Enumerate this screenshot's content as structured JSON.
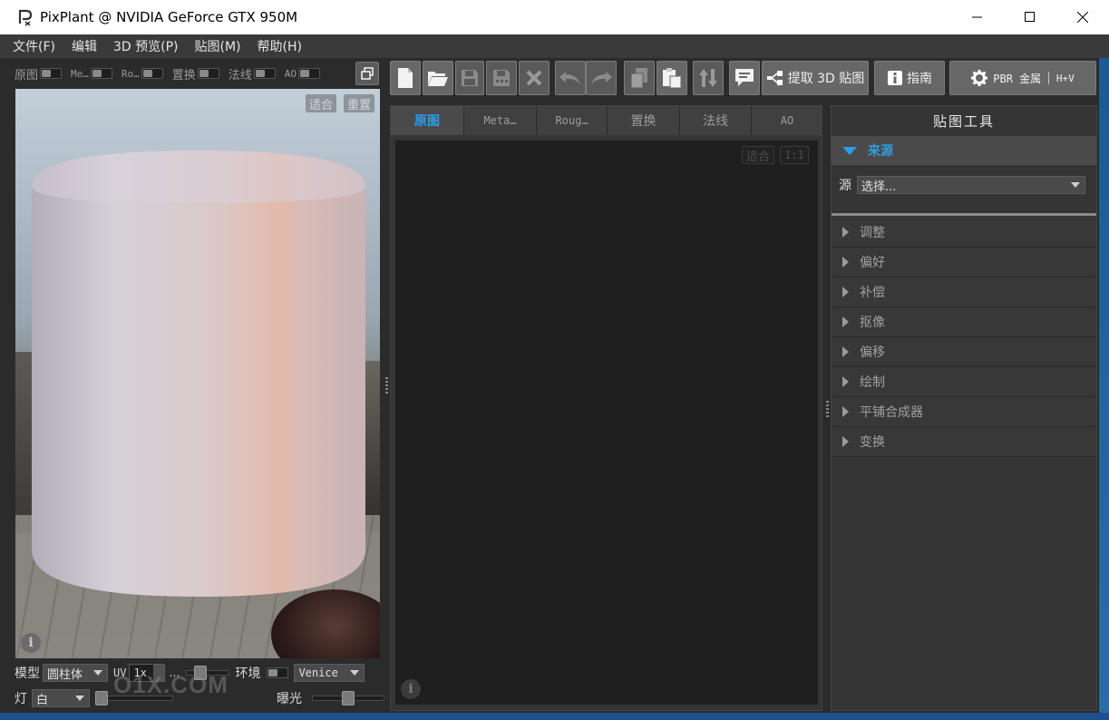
{
  "window": {
    "title": "PixPlant @ NVIDIA GeForce GTX 950M"
  },
  "menu": [
    "文件(F)",
    "编辑",
    "3D 预览(P)",
    "贴图(M)",
    "帮助(H)"
  ],
  "preview": {
    "toggles": [
      "原图",
      "Me…",
      "Ro…",
      "置换",
      "法线",
      "AO"
    ],
    "fit_button": "适合",
    "reset_button": "重置",
    "model_label": "模型",
    "model_value": "圆柱体",
    "uv_label": "UV",
    "uv_value": "1x",
    "uv_more": "…",
    "env_label": "环境",
    "env_value": "Venice",
    "light_label": "灯",
    "light_value": "白",
    "exposure_label": "曝光",
    "watermark": "O1X.COM"
  },
  "toolbar": {
    "extract_label": "提取 3D 贴图",
    "guide_label": "指南",
    "pbr_label": "PBR 金属",
    "pbr_shortcut": "H+V"
  },
  "center": {
    "tabs": [
      "原图",
      "Meta…",
      "Roug…",
      "置换",
      "法线",
      "AO"
    ],
    "fit_button": "适合",
    "one_to_one_button": "1:1"
  },
  "tools": {
    "title": "贴图工具",
    "open_section": "来源",
    "source_label": "源",
    "source_value": "选择...",
    "sections": [
      "调整",
      "偏好",
      "补偿",
      "抠像",
      "偏移",
      "绘制",
      "平铺合成器",
      "变换"
    ]
  },
  "colors": {
    "accent": "#2f9ce6",
    "panel_bg": "#353535",
    "canvas_bg": "#1f1f1f"
  },
  "icons": {
    "new": "new-file-icon",
    "open": "open-folder-icon",
    "save": "save-icon",
    "save_as": "save-as-icon",
    "close": "close-icon",
    "undo": "undo-icon",
    "redo": "redo-icon",
    "copy": "copy-icon",
    "paste": "paste-icon",
    "swap": "swap-icon",
    "comment": "comment-icon",
    "extract": "extract-icon",
    "info": "info-icon",
    "gear": "gear-icon"
  }
}
